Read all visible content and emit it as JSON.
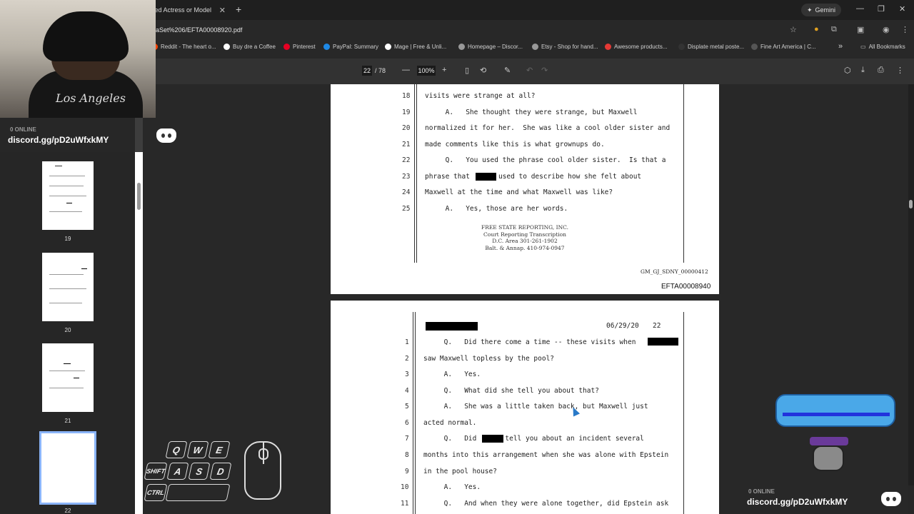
{
  "browser": {
    "tab_title": "fied Actress or Model",
    "tab_close": "✕",
    "new_tab": "+",
    "gemini_label": "Gemini",
    "url": "aSet%206/EFTA00008920.pdf",
    "window_controls": [
      "—",
      "❐",
      "✕"
    ],
    "bookmarks": [
      {
        "label": "Reddit - The heart o...",
        "color": "#ff4500"
      },
      {
        "label": "Buy dre a Coffee",
        "color": "#ffffff"
      },
      {
        "label": "Pinterest",
        "color": "#e60023"
      },
      {
        "label": "PayPal: Summary",
        "color": "#1e88e5"
      },
      {
        "label": "Mage | Free & Unli...",
        "color": "#ffffff"
      },
      {
        "label": "Homepage – Discor...",
        "color": "#999999"
      },
      {
        "label": "Etsy - Shop for hand...",
        "color": "#999999"
      },
      {
        "label": "Awesome products...",
        "color": "#e53935"
      },
      {
        "label": "Displate metal poste...",
        "color": "#333333"
      },
      {
        "label": "Fine Art America | C...",
        "color": "#555555"
      }
    ],
    "bookmarks_more": "»",
    "all_bookmarks": "All Bookmarks"
  },
  "pdf_toolbar": {
    "current_page": "22",
    "total_pages": "/ 78",
    "zoom": "100%",
    "zoom_out": "—",
    "zoom_in": "+"
  },
  "thumbnails": [
    {
      "num": "19"
    },
    {
      "num": "20"
    },
    {
      "num": "21"
    },
    {
      "num": "22"
    }
  ],
  "page_a": {
    "lines": [
      {
        "n": "18",
        "text": "visits were strange at all?"
      },
      {
        "n": "19",
        "text": "     A.   She thought they were strange, but Maxwell"
      },
      {
        "n": "20",
        "text": "normalized it for her.  She was like a cool older sister and"
      },
      {
        "n": "21",
        "text": "made comments like this is what grownups do."
      },
      {
        "n": "22",
        "text": "     Q.   You used the phrase cool older sister.  Is that a"
      },
      {
        "n": "23",
        "text": "phrase that       used to describe how she felt about"
      },
      {
        "n": "24",
        "text": "Maxwell at the time and what Maxwell was like?"
      },
      {
        "n": "25",
        "text": "     A.   Yes, those are her words."
      }
    ],
    "footer": [
      "FREE STATE REPORTING, INC.",
      "Court Reporting  Transcription",
      "D.C. Area 301-261-1902",
      "Balt. & Annap. 410-974-0947"
    ],
    "stamp": "GM_GJ_SDNY_00000412",
    "efta": "EFTA00008940"
  },
  "page_b": {
    "header_date": "06/29/20",
    "header_page": "22",
    "lines": [
      {
        "n": "1",
        "text": "     Q.   Did there come a time -- these visits when"
      },
      {
        "n": "2",
        "text": "saw Maxwell topless by the pool?"
      },
      {
        "n": "3",
        "text": "     A.   Yes."
      },
      {
        "n": "4",
        "text": "     Q.   What did she tell you about that?"
      },
      {
        "n": "5",
        "text": "     A.   She was a little taken back, but Maxwell just"
      },
      {
        "n": "6",
        "text": "acted normal."
      },
      {
        "n": "7",
        "text": "     Q.   Did       tell you about an incident several"
      },
      {
        "n": "8",
        "text": "months into this arrangement when she was alone with Epstein"
      },
      {
        "n": "9",
        "text": "in the pool house?"
      },
      {
        "n": "10",
        "text": "     A.   Yes."
      },
      {
        "n": "11",
        "text": "     Q.   And when they were alone together, did Epstein ask"
      }
    ]
  },
  "overlay": {
    "discord_online": "0 ONLINE",
    "discord_link": "discord.gg/pD2uWfxkMY",
    "shirt_text": "Los Angeles",
    "keys": [
      "Q",
      "W",
      "E",
      "SHIFT",
      "A",
      "S",
      "D",
      "CTRL"
    ]
  }
}
